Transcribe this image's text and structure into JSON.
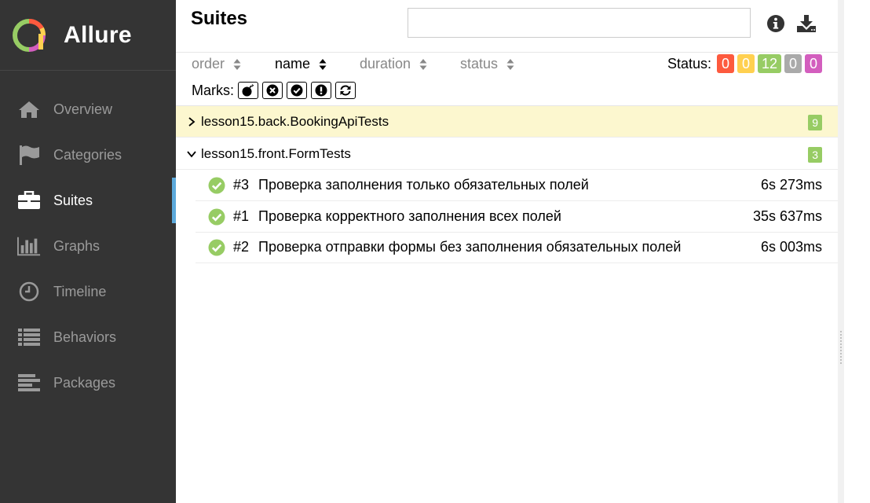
{
  "app": {
    "name": "Allure"
  },
  "sidebar": {
    "items": [
      {
        "label": "Overview",
        "icon": "home-icon"
      },
      {
        "label": "Categories",
        "icon": "flag-icon"
      },
      {
        "label": "Suites",
        "icon": "briefcase-icon",
        "active": true
      },
      {
        "label": "Graphs",
        "icon": "bar-chart-icon"
      },
      {
        "label": "Timeline",
        "icon": "clock-icon"
      },
      {
        "label": "Behaviors",
        "icon": "list-icon"
      },
      {
        "label": "Packages",
        "icon": "align-left-icon"
      }
    ]
  },
  "header": {
    "title": "Suites",
    "search_value": "",
    "search_placeholder": "",
    "info_icon": "info-icon",
    "download_icon": "download-icon"
  },
  "toolbar": {
    "sort": {
      "order": "order",
      "name": "name",
      "duration": "duration",
      "status": "status",
      "active": "name"
    },
    "status_label": "Status:",
    "status_counts": {
      "failed": "0",
      "broken": "0",
      "passed": "12",
      "skipped": "0",
      "unknown": "0"
    },
    "marks_label": "Marks:",
    "mark_icons": [
      "bomb-icon",
      "times-circle-icon",
      "check-circle-icon",
      "exclamation-circle-icon",
      "refresh-icon"
    ]
  },
  "suites": [
    {
      "name": "lesson15.back.BookingApiTests",
      "count": "9",
      "expanded": false,
      "highlighted": true,
      "tests": []
    },
    {
      "name": "lesson15.front.FormTests",
      "count": "3",
      "expanded": true,
      "highlighted": false,
      "tests": [
        {
          "num": "#3",
          "name": "Проверка заполнения только обязательных полей",
          "duration": "6s 273ms"
        },
        {
          "num": "#1",
          "name": "Проверка корректного заполнения всех полей",
          "duration": "35s 637ms"
        },
        {
          "num": "#2",
          "name": "Проверка отправки формы без заполнения обязательных полей",
          "duration": "6s 003ms"
        }
      ]
    }
  ],
  "colors": {
    "sidebar_bg": "#343434",
    "accent": "#5ca9db",
    "failed": "#fd5a3e",
    "broken": "#ffd050",
    "passed": "#97cc64",
    "skipped": "#aaaaaa",
    "unknown": "#d35ebe",
    "highlight_row": "#fcf7cf"
  }
}
